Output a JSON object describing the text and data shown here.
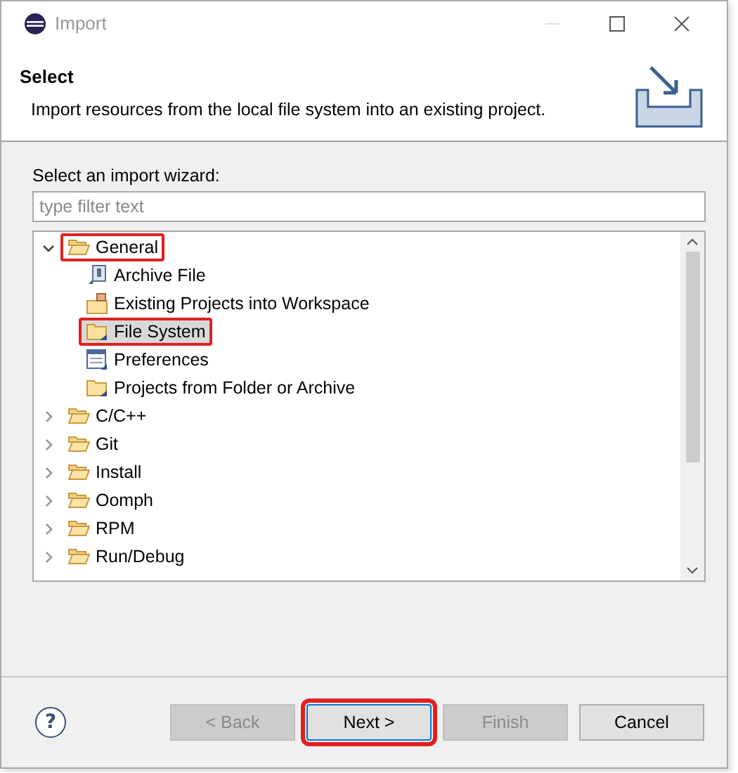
{
  "window": {
    "title": "Import"
  },
  "header": {
    "title": "Select",
    "description": "Import resources from the local file system into an existing project."
  },
  "wizard_label": "Select an import wizard:",
  "filter": {
    "placeholder": "type filter text"
  },
  "tree": [
    {
      "label": "General",
      "kind": "folder",
      "expanded": true,
      "selected": false,
      "highlighted": true,
      "children": [
        {
          "label": "Archive File",
          "kind": "archive",
          "selected": false,
          "highlighted": false
        },
        {
          "label": "Existing Projects into Workspace",
          "kind": "projects",
          "selected": false,
          "highlighted": false
        },
        {
          "label": "File System",
          "kind": "folder",
          "selected": true,
          "highlighted": true
        },
        {
          "label": "Preferences",
          "kind": "preferences",
          "selected": false,
          "highlighted": false
        },
        {
          "label": "Projects from Folder or Archive",
          "kind": "folder",
          "selected": false,
          "highlighted": false
        }
      ]
    },
    {
      "label": "C/C++",
      "kind": "folder",
      "expanded": false,
      "selected": false,
      "highlighted": false
    },
    {
      "label": "Git",
      "kind": "folder",
      "expanded": false,
      "selected": false,
      "highlighted": false
    },
    {
      "label": "Install",
      "kind": "folder",
      "expanded": false,
      "selected": false,
      "highlighted": false
    },
    {
      "label": "Oomph",
      "kind": "folder",
      "expanded": false,
      "selected": false,
      "highlighted": false
    },
    {
      "label": "RPM",
      "kind": "folder",
      "expanded": false,
      "selected": false,
      "highlighted": false
    },
    {
      "label": "Run/Debug",
      "kind": "folder",
      "expanded": false,
      "selected": false,
      "highlighted": false
    }
  ],
  "help": "?",
  "buttons": [
    {
      "label": "< Back",
      "disabled": true,
      "highlighted": false
    },
    {
      "label": "Next >",
      "disabled": false,
      "highlighted": true
    },
    {
      "label": "Finish",
      "disabled": true,
      "highlighted": false
    },
    {
      "label": "Cancel",
      "disabled": false,
      "highlighted": false
    }
  ]
}
